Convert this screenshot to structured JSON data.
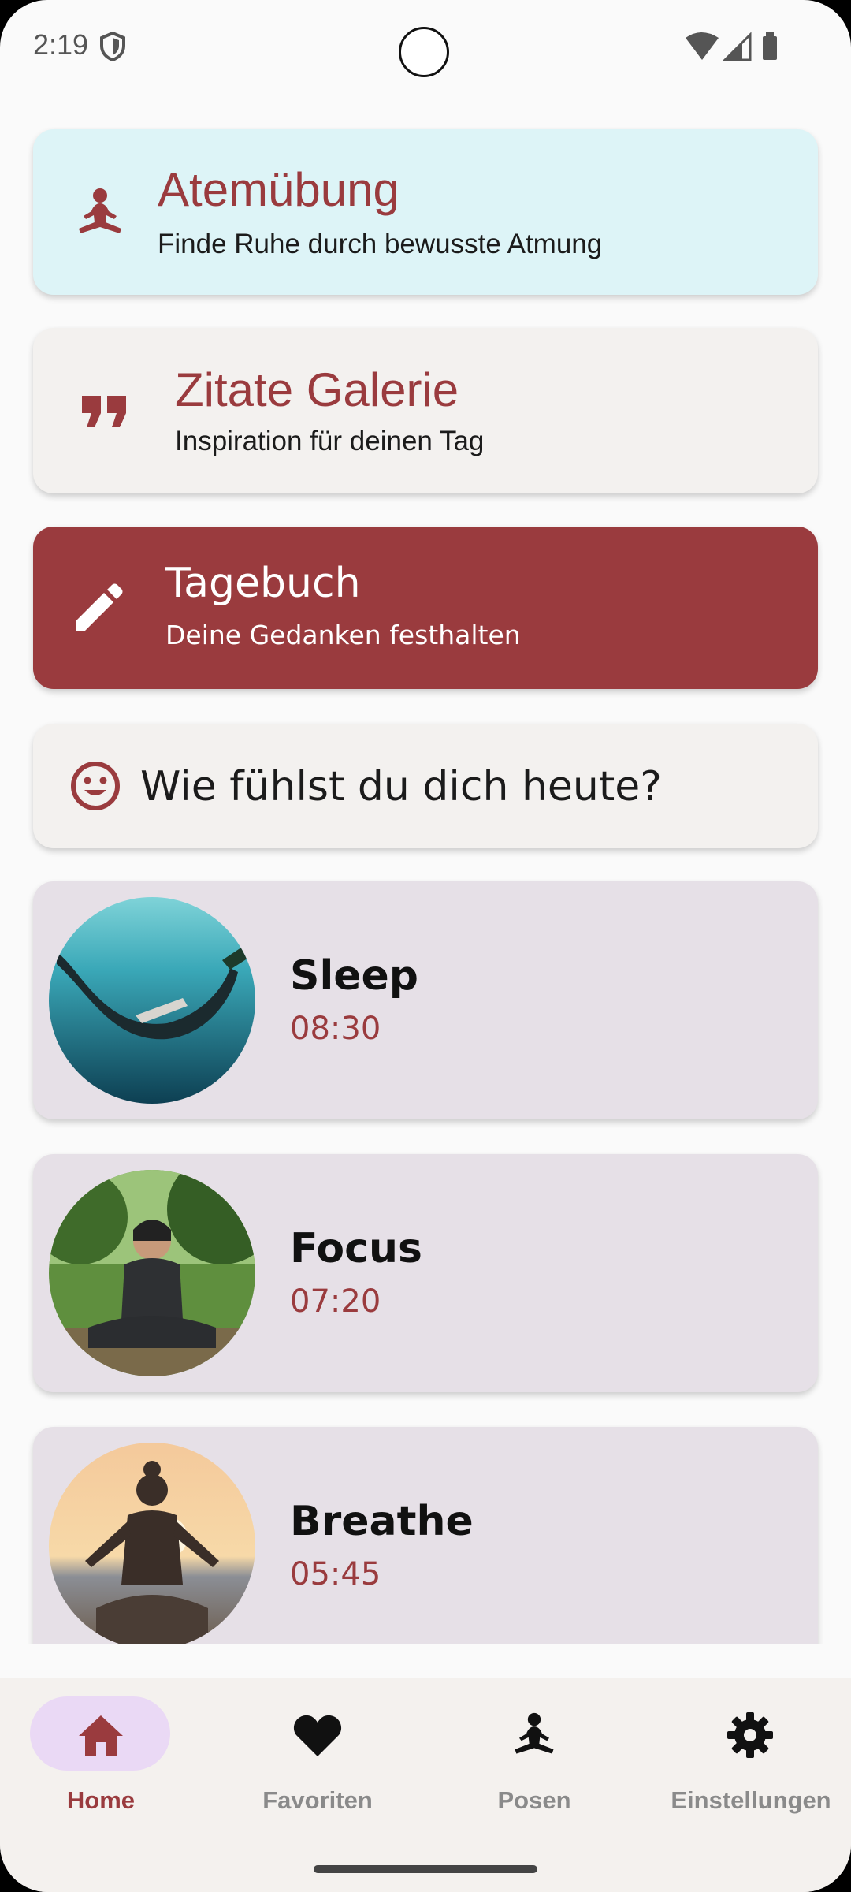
{
  "status": {
    "time": "2:19"
  },
  "cards": {
    "breathing": {
      "title": "Atemübung",
      "subtitle": "Finde Ruhe durch bewusste Atmung",
      "bg": "#ddf4f7"
    },
    "quotes": {
      "title": "Zitate Galerie",
      "subtitle": "Inspiration für deinen Tag",
      "bg": "#f3f1ef"
    },
    "journal": {
      "title": "Tagebuch",
      "subtitle": "Deine Gedanken festhalten",
      "bg": "#9a3b3e"
    },
    "mood": {
      "text": "Wie fühlst du dich heute?",
      "bg": "#f3f1ef"
    }
  },
  "sessions": [
    {
      "name": "Sleep",
      "time": "08:30"
    },
    {
      "name": "Focus",
      "time": "07:20"
    },
    {
      "name": "Breathe",
      "time": "05:45"
    }
  ],
  "nav": [
    {
      "label": "Home",
      "icon": "home-icon"
    },
    {
      "label": "Favoriten",
      "icon": "heart-icon"
    },
    {
      "label": "Posen",
      "icon": "meditation-icon"
    },
    {
      "label": "Einstellungen",
      "icon": "gear-icon"
    }
  ],
  "colors": {
    "accent": "#9a3b3e",
    "session_bg": "#e6e0e7",
    "nav_active_bg": "#ead9f5"
  }
}
